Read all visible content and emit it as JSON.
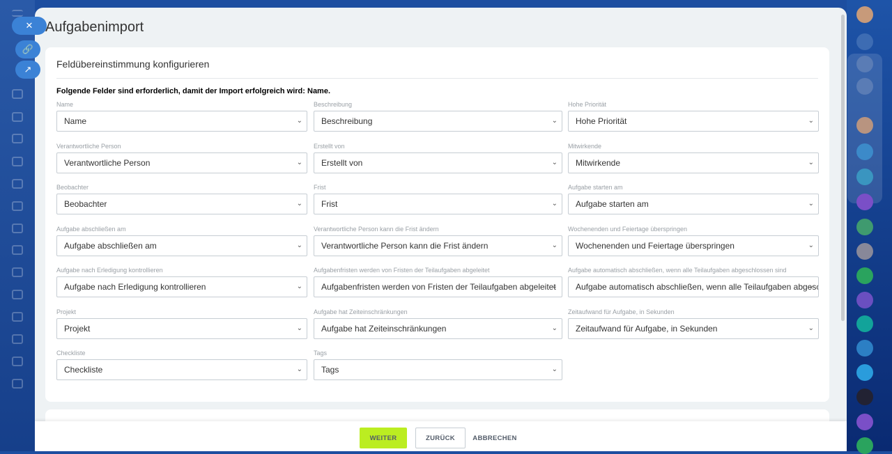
{
  "title": "Aufgabenimport",
  "card_title": "Feldübereinstimmung konfigurieren",
  "required_note": "Folgende Felder sind erforderlich, damit der Import erfolgreich wird: Name.",
  "fields": [
    {
      "label": "Name",
      "value": "Name"
    },
    {
      "label": "Beschreibung",
      "value": "Beschreibung"
    },
    {
      "label": "Hohe Priorität",
      "value": "Hohe Priorität"
    },
    {
      "label": "Verantwortliche Person",
      "value": "Verantwortliche Person"
    },
    {
      "label": "Erstellt von",
      "value": "Erstellt von"
    },
    {
      "label": "Mitwirkende",
      "value": "Mitwirkende"
    },
    {
      "label": "Beobachter",
      "value": "Beobachter"
    },
    {
      "label": "Frist",
      "value": "Frist"
    },
    {
      "label": "Aufgabe starten am",
      "value": "Aufgabe starten am"
    },
    {
      "label": "Aufgabe abschließen am",
      "value": "Aufgabe abschließen am"
    },
    {
      "label": "Verantwortliche Person kann die Frist ändern",
      "value": "Verantwortliche Person kann die Frist ändern"
    },
    {
      "label": "Wochenenden und Feiertage überspringen",
      "value": "Wochenenden und Feiertage überspringen"
    },
    {
      "label": "Aufgabe nach Erledigung kontrollieren",
      "value": "Aufgabe nach Erledigung kontrollieren"
    },
    {
      "label": "Aufgabenfristen werden von Fristen der Teilaufgaben abgeleitet",
      "value": "Aufgabenfristen werden von Fristen der Teilaufgaben abgeleitet"
    },
    {
      "label": "Aufgabe automatisch abschließen, wenn alle Teilaufgaben abgeschlossen sind",
      "value": "Aufgabe automatisch abschließen, wenn alle Teilaufgaben abgeschlossen sind"
    },
    {
      "label": "Projekt",
      "value": "Projekt"
    },
    {
      "label": "Aufgabe hat Zeiteinschränkungen",
      "value": "Aufgabe hat Zeiteinschränkungen"
    },
    {
      "label": "Zeitaufwand für Aufgabe, in Sekunden",
      "value": "Zeitaufwand für Aufgabe, in Sekunden"
    },
    {
      "label": "Checkliste",
      "value": "Checkliste"
    },
    {
      "label": "Tags",
      "value": "Tags"
    }
  ],
  "buttons": {
    "next": "WEITER",
    "back": "ZURÜCK",
    "cancel": "ABBRECHEN"
  },
  "colors": {
    "accent": "#bbed21"
  }
}
